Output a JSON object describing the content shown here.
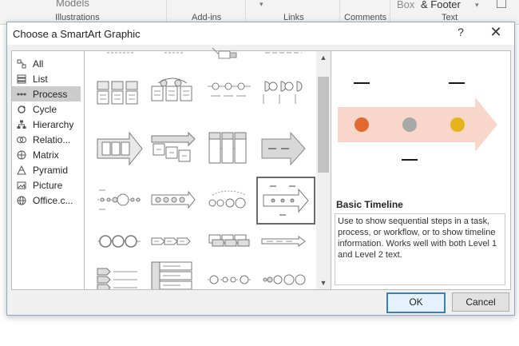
{
  "ribbon": {
    "models": "Models",
    "illustrations": "Illustrations",
    "addins": "Add-ins",
    "links": "Links",
    "comments": "Comments",
    "box": "Box",
    "header_footer": "& Footer",
    "text": "Text"
  },
  "dialog": {
    "title": "Choose a SmartArt Graphic",
    "help": "?",
    "close": "✕"
  },
  "categories": [
    {
      "label": "All",
      "icon": "all-icon"
    },
    {
      "label": "List",
      "icon": "list-icon"
    },
    {
      "label": "Process",
      "icon": "process-icon",
      "selected": true
    },
    {
      "label": "Cycle",
      "icon": "cycle-icon"
    },
    {
      "label": "Hierarchy",
      "icon": "hierarchy-icon"
    },
    {
      "label": "Relatio...",
      "icon": "relationship-icon"
    },
    {
      "label": "Matrix",
      "icon": "matrix-icon"
    },
    {
      "label": "Pyramid",
      "icon": "pyramid-icon"
    },
    {
      "label": "Picture",
      "icon": "picture-icon"
    },
    {
      "label": "Office.c...",
      "icon": "office-icon"
    }
  ],
  "gallery": {
    "selected_layout": "basic-timeline"
  },
  "preview": {
    "name": "Basic Timeline",
    "description": "Use to show sequential steps in a task, process, or workflow, or to show timeline information. Works well with both Level 1 and Level 2 text.",
    "dot_colors": [
      "#e06a30",
      "#a8a8a8",
      "#e6b419"
    ],
    "arrow_color": "#f8d6c9"
  },
  "buttons": {
    "ok": "OK",
    "cancel": "Cancel"
  }
}
